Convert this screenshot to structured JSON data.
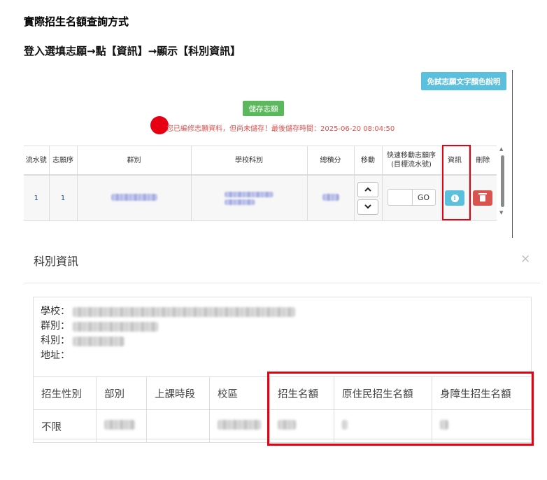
{
  "headings": {
    "title": "實際招生名額查詢方式",
    "subtitle": "登入選填志願→點【資訊】→顯示【科別資訊】"
  },
  "toolbar": {
    "help_button": "免試志願文字顏色說明",
    "save_button": "儲存志願",
    "warning": "您已編修志願資料，但尚未儲存！最後儲存時間：2025-06-20 08:04:50"
  },
  "volunteer_table": {
    "headers": [
      "流水號",
      "志願序",
      "群別",
      "學校科別",
      "總積分",
      "移動",
      "快速移動志願序\n(目標流水號)",
      "資訊",
      "刪除"
    ],
    "rows": [
      {
        "serial": "1",
        "order": "1",
        "go_button": "GO"
      }
    ]
  },
  "modal": {
    "title": "科別資訊",
    "close": "×",
    "info_labels": {
      "school": "學校：",
      "group": "群別：",
      "department": "科別：",
      "address": "地址："
    },
    "table": {
      "headers": [
        "招生性別",
        "部別",
        "上課時段",
        "校區",
        "招生名額",
        "原住民招生名額",
        "身障生招生名額"
      ],
      "row": {
        "gender": "不限"
      }
    }
  },
  "colors": {
    "highlight_red": "#e60012",
    "info_blue": "#5bc0de",
    "save_green": "#5cb85c",
    "delete_red": "#d9534f"
  }
}
